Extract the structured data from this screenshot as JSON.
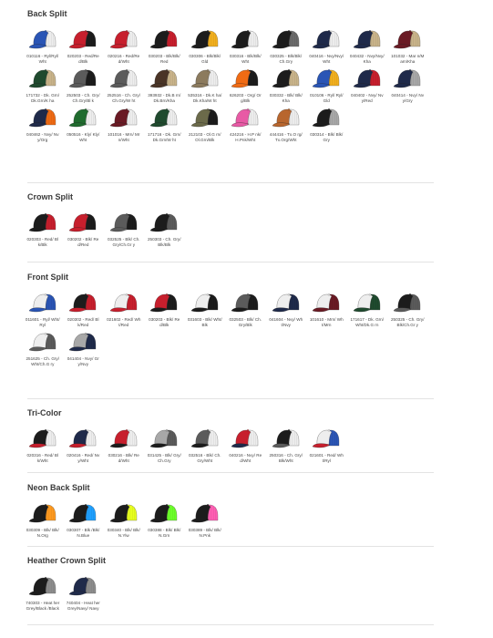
{
  "sections": [
    {
      "title": "Back Split",
      "items": [
        {
          "code": "010116 - Ryl/Ryl/Wht",
          "visor": "#2a55b5",
          "front": "#2a55b5",
          "mesh": "#eeeeee"
        },
        {
          "code": "020203 - Red/Red/Blk",
          "visor": "#c71f2d",
          "front": "#c71f2d",
          "mesh": "#1c1c1c"
        },
        {
          "code": "020216 - Red/Red/Wht",
          "visor": "#c71f2d",
          "front": "#c71f2d",
          "mesh": "#eeeeee"
        },
        {
          "code": "030203 - Blk/Blk/Red",
          "visor": "#1c1c1c",
          "front": "#1c1c1c",
          "mesh": "#c71f2d"
        },
        {
          "code": "030306 - Blk/Blk/Gld",
          "visor": "#1c1c1c",
          "front": "#1c1c1c",
          "mesh": "#f2b01e"
        },
        {
          "code": "030316 - Blk/Blk/Wht",
          "visor": "#1c1c1c",
          "front": "#1c1c1c",
          "mesh": "#eeeeee"
        },
        {
          "code": "030325 - Blk/Blk/Ch.Gry",
          "visor": "#1c1c1c",
          "front": "#1c1c1c",
          "mesh": "#6b6b6b"
        },
        {
          "code": "040416 - Nvy/Nvy/Wht",
          "visor": "#1f2a4a",
          "front": "#1f2a4a",
          "mesh": "#eeeeee"
        },
        {
          "code": "040432 - Nvy/Nvy/Kha",
          "visor": "#1f2a4a",
          "front": "#1f2a4a",
          "mesh": "#c9b48a"
        },
        {
          "code": "101032 - Mar n/Marn/Kha",
          "visor": "#6a1a24",
          "front": "#6a1a24",
          "mesh": "#c9b48a"
        },
        {
          "code": "171732 - Dk. Grn/Dk.Grn/K ha",
          "visor": "#1f4a2e",
          "front": "#1f4a2e",
          "mesh": "#c9b48a"
        },
        {
          "code": "252503 - Ch. Gry/Ch.Gry/Bl k",
          "visor": "#5b5b5b",
          "front": "#5b5b5b",
          "mesh": "#1c1c1c"
        },
        {
          "code": "252516 - Ch. Gry/Ch.Gry/W ht",
          "visor": "#5b5b5b",
          "front": "#5b5b5b",
          "mesh": "#eeeeee"
        },
        {
          "code": "393932 - Dk.B rn/Dk.Brn/Kha",
          "visor": "#4a3426",
          "front": "#4a3426",
          "mesh": "#c9b48a"
        },
        {
          "code": "535316 - Dk.K ha/Dk.Kha/W ht",
          "visor": "#8c7b5e",
          "front": "#8c7b5e",
          "mesh": "#eeeeee"
        },
        {
          "code": "626203 - Org/ Org/Blk",
          "visor": "#f06b14",
          "front": "#f06b14",
          "mesh": "#1c1c1c"
        },
        {
          "code": "030332 - Blk/ Blk/Kha",
          "visor": "#1c1c1c",
          "front": "#1c1c1c",
          "mesh": "#c9b48a"
        },
        {
          "code": "010106 - Ryl/ Ryl/Gld",
          "visor": "#2a55b5",
          "front": "#2a55b5",
          "mesh": "#f2b01e"
        },
        {
          "code": "040402 - Nvy/ Nvy/Red",
          "visor": "#1f2a4a",
          "front": "#1f2a4a",
          "mesh": "#c71f2d"
        },
        {
          "code": "040414 - Nvy/ Nvy/Gry",
          "visor": "#1f2a4a",
          "front": "#1f2a4a",
          "mesh": "#a8a8a8"
        },
        {
          "code": "040462 - Nvy/ Nvy/Org",
          "visor": "#1f2a4a",
          "front": "#1f2a4a",
          "mesh": "#f06b14"
        },
        {
          "code": "050516 - Kly/ Kly/Wht",
          "visor": "#1f6b2e",
          "front": "#1f6b2e",
          "mesh": "#eeeeee"
        },
        {
          "code": "101016 - Mrn/ Mrn/Wht",
          "visor": "#6a1a24",
          "front": "#6a1a24",
          "mesh": "#eeeeee"
        },
        {
          "code": "171716 - Dk. Grn/Dk.Grn/W ht",
          "visor": "#1f4a2e",
          "front": "#1f4a2e",
          "mesh": "#eeeeee"
        },
        {
          "code": "212103 - Ol.G rn/Ol.Grn/Blk",
          "visor": "#6b6a4a",
          "front": "#6b6a4a",
          "mesh": "#1c1c1c"
        },
        {
          "code": "424216 - H.P nk/H.Pnk/Wht",
          "visor": "#e85aa5",
          "front": "#e85aa5",
          "mesh": "#eeeeee"
        },
        {
          "code": "444416 - Tx.O rg/Tx.Org/Wht",
          "visor": "#b8662e",
          "front": "#b8662e",
          "mesh": "#eeeeee"
        },
        {
          "code": "030314 - Blk/ Blk/Gry",
          "visor": "#1c1c1c",
          "front": "#1c1c1c",
          "mesh": "#a8a8a8"
        }
      ]
    },
    {
      "title": "Crown Split",
      "items": [
        {
          "code": "020303 - Red/ Blk/Blk",
          "visor": "#1c1c1c",
          "front": "#1c1c1c",
          "mesh": "#c71f2d"
        },
        {
          "code": "030202 - Blk/ Red/Red",
          "visor": "#c71f2d",
          "front": "#c71f2d",
          "mesh": "#1c1c1c"
        },
        {
          "code": "032525 - Blk/ Ch.Gry/Ch.Gr y",
          "visor": "#5b5b5b",
          "front": "#5b5b5b",
          "mesh": "#1c1c1c"
        },
        {
          "code": "250303 - Ch. Gry/Blk/Blk",
          "visor": "#1c1c1c",
          "front": "#1c1c1c",
          "mesh": "#5b5b5b"
        }
      ]
    },
    {
      "title": "Front Split",
      "items": [
        {
          "code": "011601 - Ryl/ Wht/Ryl",
          "visor": "#2a55b5",
          "front": "#eeeeee",
          "mesh": "#2a55b5"
        },
        {
          "code": "020302 - Red/ Blk/Red",
          "visor": "#c71f2d",
          "front": "#1c1c1c",
          "mesh": "#c71f2d"
        },
        {
          "code": "021602 - Red/ Wht/Red",
          "visor": "#c71f2d",
          "front": "#eeeeee",
          "mesh": "#c71f2d"
        },
        {
          "code": "030203 - Blk/ Red/Blk",
          "visor": "#1c1c1c",
          "front": "#c71f2d",
          "mesh": "#1c1c1c"
        },
        {
          "code": "031603 - Blk/ Wht/Blk",
          "visor": "#1c1c1c",
          "front": "#eeeeee",
          "mesh": "#1c1c1c"
        },
        {
          "code": "032503 - Blk/ Ch.Gry/Blk",
          "visor": "#1c1c1c",
          "front": "#5b5b5b",
          "mesh": "#1c1c1c"
        },
        {
          "code": "041604 - Nvy/ Wht/Nvy",
          "visor": "#1f2a4a",
          "front": "#eeeeee",
          "mesh": "#1f2a4a"
        },
        {
          "code": "101610 - Mrn/ Wht/Mrn",
          "visor": "#6a1a24",
          "front": "#eeeeee",
          "mesh": "#6a1a24"
        },
        {
          "code": "171617 - Dk. Grn/Wht/Dk.G rn",
          "visor": "#1f4a2e",
          "front": "#eeeeee",
          "mesh": "#1f4a2e"
        },
        {
          "code": "250325 - Ch. Gry/Blk/Ch.Gr y",
          "visor": "#5b5b5b",
          "front": "#1c1c1c",
          "mesh": "#5b5b5b"
        },
        {
          "code": "251625 - Ch. Gry/Wht/Ch.G ry",
          "visor": "#5b5b5b",
          "front": "#eeeeee",
          "mesh": "#5b5b5b"
        },
        {
          "code": "041404 - Nvy/ Gry/Nvy",
          "visor": "#1f2a4a",
          "front": "#a8a8a8",
          "mesh": "#1f2a4a"
        }
      ]
    },
    {
      "title": "Tri-Color",
      "items": [
        {
          "code": "020316 - Red/ Blk/Wht",
          "visor": "#c71f2d",
          "front": "#1c1c1c",
          "mesh": "#eeeeee"
        },
        {
          "code": "020416 - Red/ Nvy/Wht",
          "visor": "#c71f2d",
          "front": "#1f2a4a",
          "mesh": "#eeeeee"
        },
        {
          "code": "030216 - Blk/ Red/Wht",
          "visor": "#1c1c1c",
          "front": "#c71f2d",
          "mesh": "#eeeeee"
        },
        {
          "code": "031425 - Blk/ Gry/Ch.Gry",
          "visor": "#1c1c1c",
          "front": "#a8a8a8",
          "mesh": "#5b5b5b"
        },
        {
          "code": "032516 - Blk/ Ch.Gry/Wht",
          "visor": "#1c1c1c",
          "front": "#5b5b5b",
          "mesh": "#eeeeee"
        },
        {
          "code": "040216 - Nvy/ Red/Wht",
          "visor": "#1f2a4a",
          "front": "#c71f2d",
          "mesh": "#eeeeee"
        },
        {
          "code": "250316 - Ch. Gry/Blk/Wht",
          "visor": "#5b5b5b",
          "front": "#1c1c1c",
          "mesh": "#eeeeee"
        },
        {
          "code": "021601 - Red/ Wht/Ryl",
          "visor": "#c71f2d",
          "front": "#eeeeee",
          "mesh": "#2a55b5"
        }
      ]
    },
    {
      "title": "Neon Back Split",
      "items": [
        {
          "code": "030309 - Blk/ Blk/N.Org",
          "visor": "#1c1c1c",
          "front": "#1c1c1c",
          "mesh": "#ff9a1f"
        },
        {
          "code": "030307 - Blk /Blk/N.Blue",
          "visor": "#1c1c1c",
          "front": "#1c1c1c",
          "mesh": "#1fa0ff"
        },
        {
          "code": "030340 - Blk/ Blk/N.Ylw",
          "visor": "#1c1c1c",
          "front": "#1c1c1c",
          "mesh": "#e8ff1f"
        },
        {
          "code": "030388 - Blk/ Blk/N.Grn",
          "visor": "#1c1c1c",
          "front": "#1c1c1c",
          "mesh": "#6cff2a"
        },
        {
          "code": "030389 - Blk/ Blk/N.Pnk",
          "visor": "#1c1c1c",
          "front": "#1c1c1c",
          "mesh": "#ff5fb4"
        }
      ]
    },
    {
      "title": "Heather Crown Split",
      "items": [
        {
          "code": "740303 - Heat herGrey/Black /Black",
          "visor": "#1c1c1c",
          "front": "#1c1c1c",
          "mesh": "#8d8d8d"
        },
        {
          "code": "740404 - Heat herGrey/Navy/ Navy",
          "visor": "#1f2a4a",
          "front": "#1f2a4a",
          "mesh": "#8d8d8d"
        }
      ]
    }
  ]
}
